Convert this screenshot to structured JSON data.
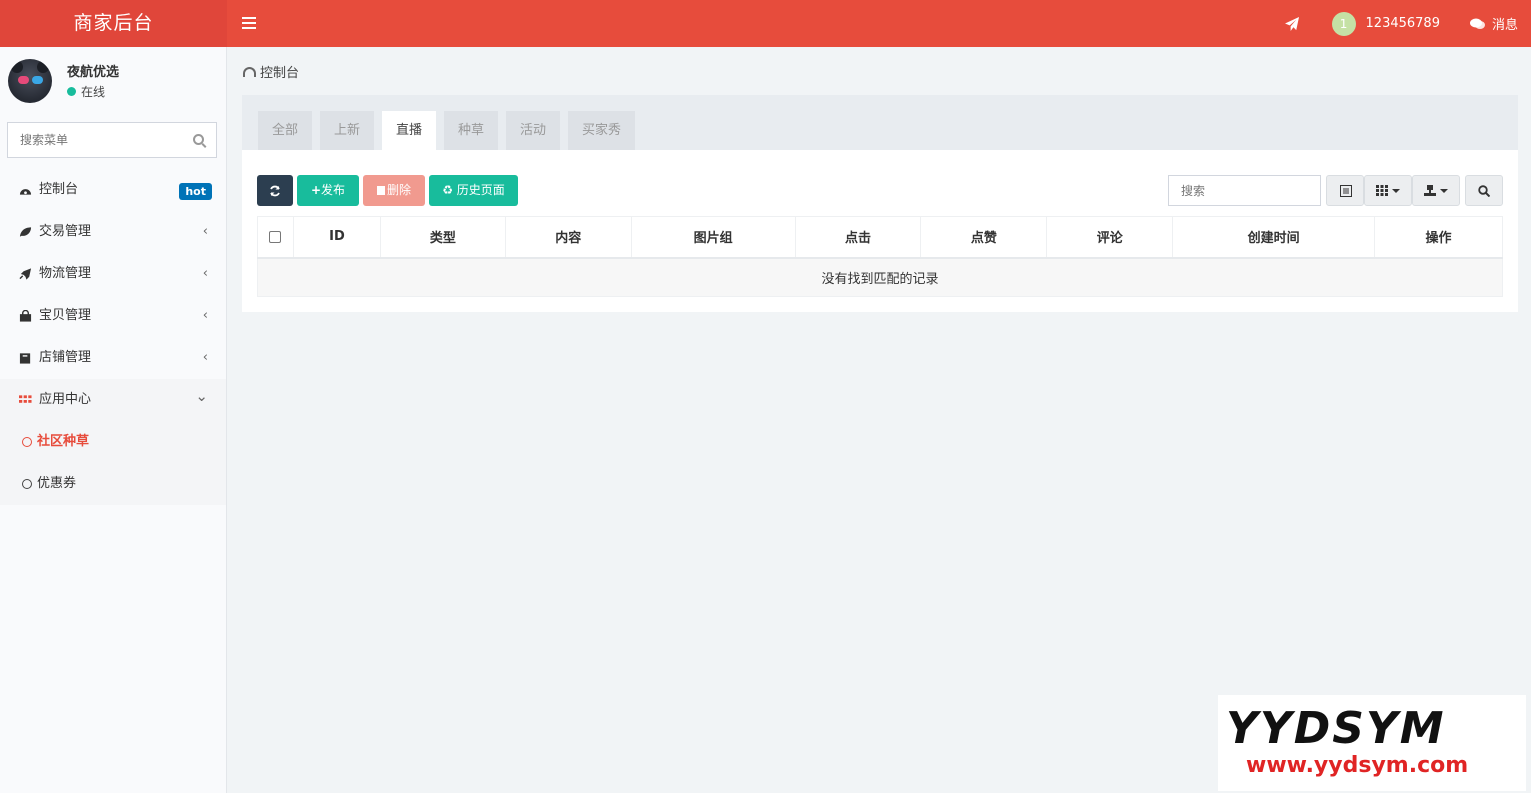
{
  "header": {
    "logo": "商家后台",
    "user_badge": "1",
    "username": "123456789",
    "messages": "消息"
  },
  "sidebar": {
    "user_name": "夜航优选",
    "user_status": "在线",
    "search_placeholder": "搜索菜单",
    "items": [
      {
        "label": "控制台",
        "icon": "dashboard-icon",
        "badge": "hot"
      },
      {
        "label": "交易管理",
        "icon": "leaf-icon",
        "arrow": "‹"
      },
      {
        "label": "物流管理",
        "icon": "rocket-icon",
        "arrow": "‹"
      },
      {
        "label": "宝贝管理",
        "icon": "shopping-bag-icon",
        "arrow": "‹"
      },
      {
        "label": "店铺管理",
        "icon": "store-icon",
        "arrow": "‹"
      },
      {
        "label": "应用中心",
        "icon": "apps-grid-icon",
        "arrow": "⌄"
      }
    ],
    "sub_items": [
      {
        "label": "社区种草",
        "active": true
      },
      {
        "label": "优惠券",
        "active": false
      }
    ]
  },
  "breadcrumb": "控制台",
  "tabs": [
    "全部",
    "上新",
    "直播",
    "种草",
    "活动",
    "买家秀"
  ],
  "active_tab": "直播",
  "toolbar": {
    "publish": "发布",
    "delete": "删除",
    "history": "历史页面",
    "search_placeholder": "搜索"
  },
  "table": {
    "columns": [
      "ID",
      "类型",
      "内容",
      "图片组",
      "点击",
      "点赞",
      "评论",
      "创建时间",
      "操作"
    ],
    "empty_text": "没有找到匹配的记录"
  },
  "watermark": {
    "brand": "YYDSYM",
    "url": "www.yydsym.com"
  },
  "colors": {
    "header": "#e74c3c",
    "accent_green": "#18bc9c",
    "dark": "#2c3e50",
    "hot_badge": "#0073b7"
  }
}
